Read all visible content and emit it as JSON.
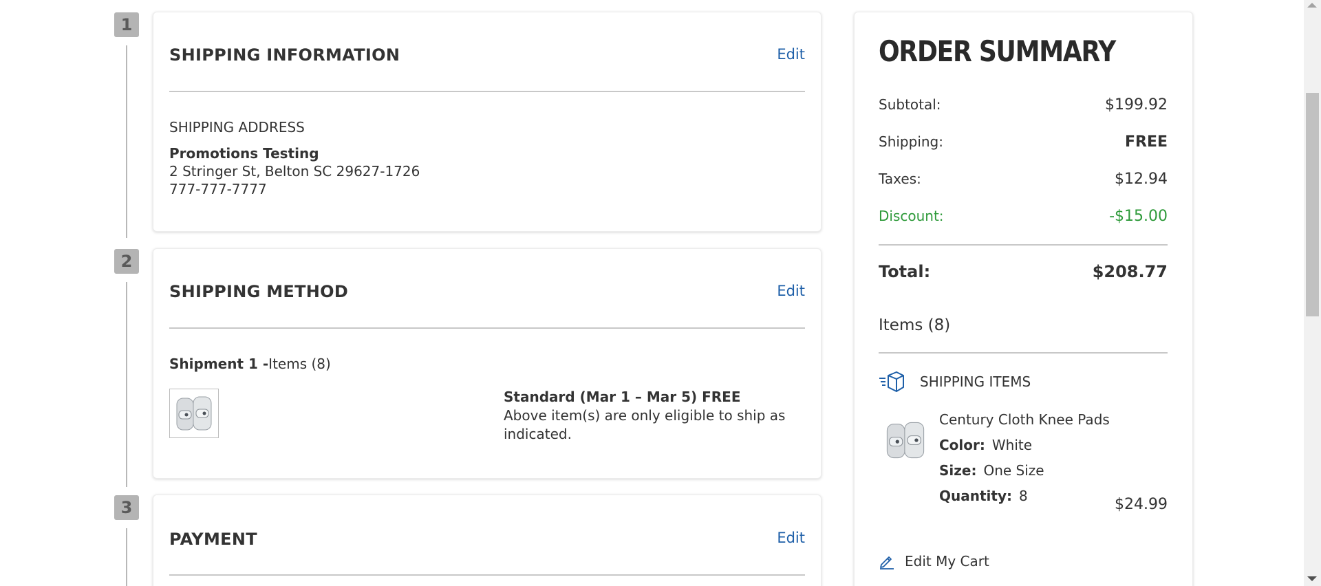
{
  "steps": [
    {
      "number": "1",
      "title": "SHIPPING INFORMATION",
      "edit_label": "Edit"
    },
    {
      "number": "2",
      "title": "SHIPPING METHOD",
      "edit_label": "Edit"
    },
    {
      "number": "3",
      "title": "PAYMENT",
      "edit_label": "Edit"
    }
  ],
  "shipping_info": {
    "label": "SHIPPING ADDRESS",
    "name": "Promotions Testing",
    "address": "2 Stringer St, Belton SC 29627-1726",
    "phone": "777-777-7777"
  },
  "shipping_method": {
    "shipment_label": "Shipment 1 -",
    "shipment_items": "Items (8)",
    "option_title": "Standard (Mar 1 – Mar 5) FREE",
    "option_note": "Above item(s) are only eligible to ship as indicated."
  },
  "summary": {
    "title": "ORDER SUMMARY",
    "subtotal_label": "Subtotal:",
    "subtotal_value": "$199.92",
    "shipping_label": "Shipping:",
    "shipping_value": "FREE",
    "taxes_label": "Taxes:",
    "taxes_value": "$12.94",
    "discount_label": "Discount:",
    "discount_value": "-$15.00",
    "total_label": "Total:",
    "total_value": "$208.77",
    "items_count": "Items (8)",
    "shipping_items_label": "SHIPPING ITEMS",
    "edit_cart_label": "Edit My Cart",
    "discount_color": "#2e9a3a",
    "link_color": "#1e5fa8"
  },
  "product": {
    "name": "Century Cloth Knee Pads",
    "color_label": "Color:",
    "color_value": "White",
    "size_label": "Size:",
    "size_value": "One Size",
    "quantity_label": "Quantity:",
    "quantity_value": "8",
    "price": "$24.99"
  },
  "icons": {
    "shipping_items": "package-box-icon",
    "edit_cart": "pencil-icon"
  }
}
